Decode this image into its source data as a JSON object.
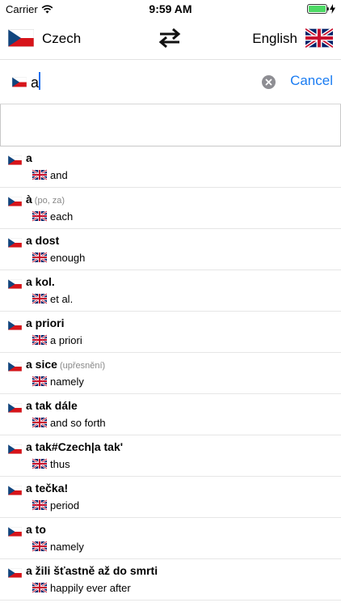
{
  "status": {
    "carrier": "Carrier",
    "time": "9:59 AM"
  },
  "header": {
    "source_lang": "Czech",
    "target_lang": "English"
  },
  "search": {
    "value": "a",
    "placeholder": "",
    "cancel_label": "Cancel"
  },
  "entries": [
    {
      "term": "a",
      "note": "",
      "translation": "and"
    },
    {
      "term": "à",
      "note": "(po, za)",
      "translation": "each"
    },
    {
      "term": "a dost",
      "note": "",
      "translation": "enough"
    },
    {
      "term": "a kol.",
      "note": "",
      "translation": "et al."
    },
    {
      "term": "a priori",
      "note": "",
      "translation": "a priori"
    },
    {
      "term": "a sice",
      "note": "(upřesnění)",
      "translation": "namely"
    },
    {
      "term": "a tak dále",
      "note": "",
      "translation": "and so forth"
    },
    {
      "term": "a tak#Czech|a tak'",
      "note": "",
      "translation": "thus"
    },
    {
      "term": "a tečka!",
      "note": "",
      "translation": "period"
    },
    {
      "term": "a to",
      "note": "",
      "translation": "namely"
    },
    {
      "term": "a žili šťastně až do smrti",
      "note": "",
      "translation": "happily ever after"
    }
  ],
  "colors": {
    "accent": "#1a7cf2",
    "battery": "#4cd964"
  }
}
